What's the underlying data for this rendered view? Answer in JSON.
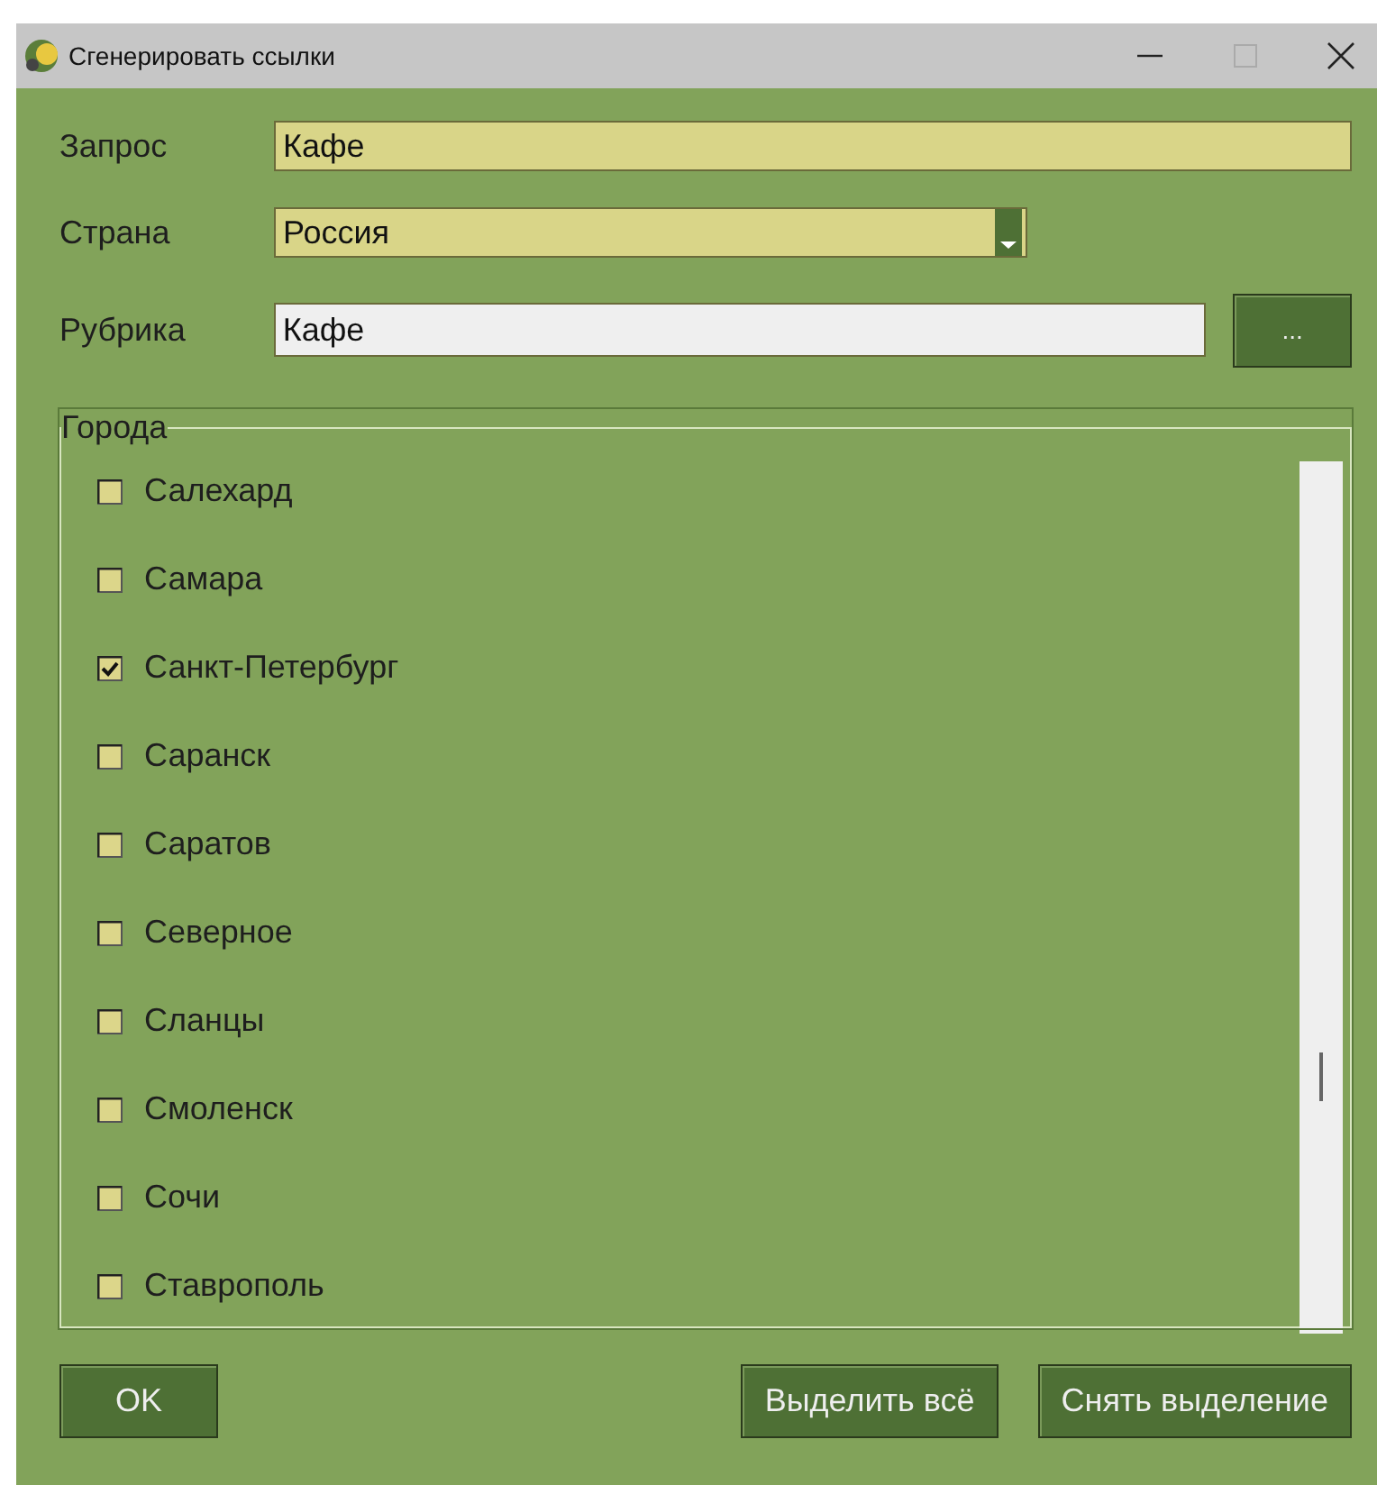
{
  "window": {
    "title": "Сгенерировать ссылки"
  },
  "form": [
    {
      "kind": "text",
      "label": "Запрос",
      "value": "Кафе"
    },
    {
      "kind": "select",
      "label": "Страна",
      "value": "Россия"
    },
    {
      "kind": "browse",
      "label": "Рубрика",
      "value": "Кафе",
      "button": "..."
    }
  ],
  "cities": {
    "title": "Города",
    "items": [
      {
        "label": "Салехард",
        "checked": false
      },
      {
        "label": "Самара",
        "checked": false
      },
      {
        "label": "Санкт-Петербург",
        "checked": true
      },
      {
        "label": "Саранск",
        "checked": false
      },
      {
        "label": "Саратов",
        "checked": false
      },
      {
        "label": "Северное",
        "checked": false
      },
      {
        "label": "Сланцы",
        "checked": false
      },
      {
        "label": "Смоленск",
        "checked": false
      },
      {
        "label": "Сочи",
        "checked": false
      },
      {
        "label": "Ставрополь",
        "checked": false
      }
    ]
  },
  "buttons": {
    "ok": "OK",
    "select_all": "Выделить всё",
    "clear": "Снять выделение"
  }
}
